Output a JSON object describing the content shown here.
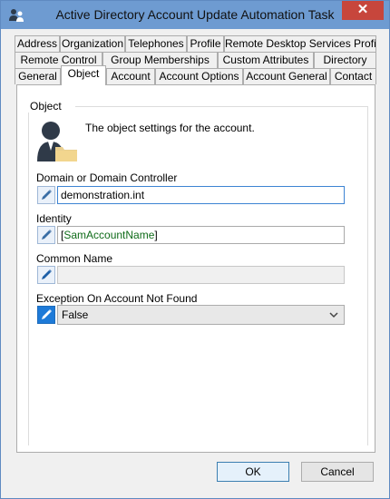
{
  "window": {
    "title": "Active Directory Account Update Automation Task",
    "close_glyph": "✕"
  },
  "tabs": {
    "row1": [
      "Address",
      "Organization",
      "Telephones",
      "Profile",
      "Remote Desktop Services Profile"
    ],
    "row2": [
      "Remote Control",
      "Group Memberships",
      "Custom Attributes",
      "Directory"
    ],
    "row3": [
      "General",
      "Object",
      "Account",
      "Account Options",
      "Account General",
      "Contact"
    ],
    "selected": "Object"
  },
  "panel": {
    "group_title": "Object",
    "description": "The object settings for the account.",
    "fields": {
      "domain": {
        "label": "Domain or Domain Controller",
        "value": "demonstration.int"
      },
      "identity": {
        "label": "Identity",
        "value_open": "[",
        "value_token": "SamAccountName",
        "value_close": "]"
      },
      "common_name": {
        "label": "Common Name",
        "value": ""
      },
      "exception": {
        "label": "Exception On Account Not Found",
        "value": "False"
      }
    }
  },
  "buttons": {
    "ok": "OK",
    "cancel": "Cancel"
  },
  "colors": {
    "title_bar": "#6e9bd1",
    "close_button": "#c7463c",
    "token_text": "#0f6b19",
    "edit_button_active": "#1d7ad8"
  },
  "icons": {
    "app": "users-icon",
    "description": "user-folder-icon",
    "edit": "pencil-icon",
    "dropdown": "chevron-down-icon"
  }
}
